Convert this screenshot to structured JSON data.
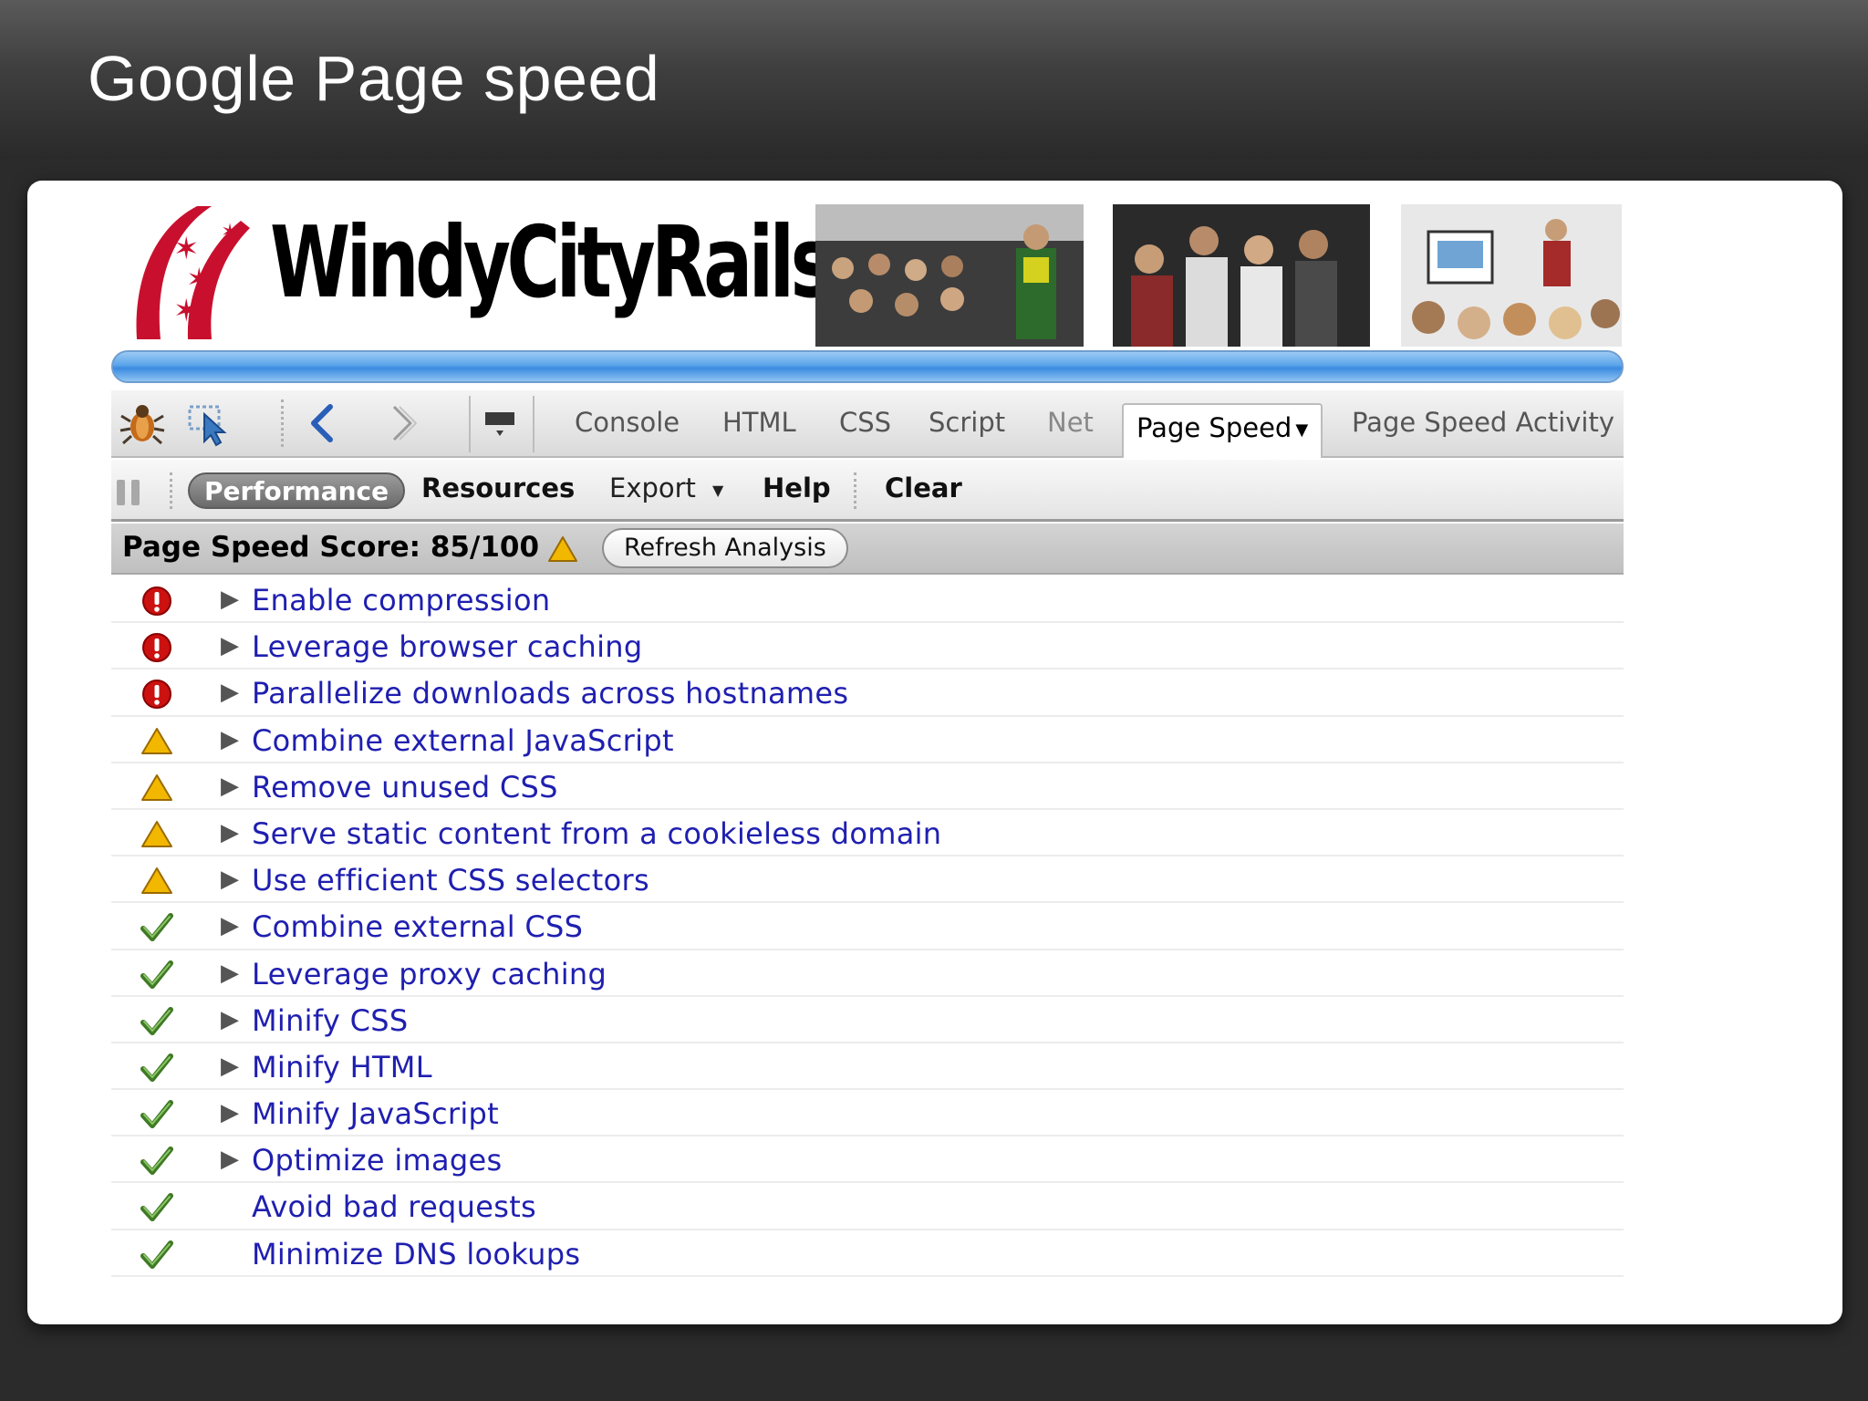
{
  "slide": {
    "title": "Google Page speed"
  },
  "banner": {
    "logo_text": "WindyCityRails",
    "photos": [
      "conference-audience-photo",
      "conference-crowd-photo",
      "conference-presentation-photo"
    ]
  },
  "toolbar": {
    "icons": [
      "firebug-icon",
      "inspect-icon",
      "back-icon",
      "forward-icon",
      "panel-menu-icon"
    ],
    "tabs": [
      {
        "label": "Console",
        "active": false
      },
      {
        "label": "HTML",
        "active": false
      },
      {
        "label": "CSS",
        "active": false
      },
      {
        "label": "Script",
        "active": false
      },
      {
        "label": "Net",
        "active": false
      },
      {
        "label": "Page Speed",
        "active": true
      },
      {
        "label": "Page Speed Activity",
        "active": false
      }
    ]
  },
  "subtoolbar": {
    "performance": "Performance",
    "resources": "Resources",
    "export": "Export",
    "help": "Help",
    "clear": "Clear"
  },
  "score": {
    "label": "Page Speed Score: 85/100",
    "value": 85,
    "max": 100,
    "refresh": "Refresh Analysis"
  },
  "rules": [
    {
      "name": "Enable compression",
      "status": "error",
      "expandable": true
    },
    {
      "name": "Leverage browser caching",
      "status": "error",
      "expandable": true
    },
    {
      "name": "Parallelize downloads across hostnames",
      "status": "error",
      "expandable": true
    },
    {
      "name": "Combine external JavaScript",
      "status": "warning",
      "expandable": true
    },
    {
      "name": "Remove unused CSS",
      "status": "warning",
      "expandable": true
    },
    {
      "name": "Serve static content from a cookieless domain",
      "status": "warning",
      "expandable": true
    },
    {
      "name": "Use efficient CSS selectors",
      "status": "warning",
      "expandable": true
    },
    {
      "name": "Combine external CSS",
      "status": "pass",
      "expandable": true
    },
    {
      "name": "Leverage proxy caching",
      "status": "pass",
      "expandable": true
    },
    {
      "name": "Minify CSS",
      "status": "pass",
      "expandable": true
    },
    {
      "name": "Minify HTML",
      "status": "pass",
      "expandable": true
    },
    {
      "name": "Minify JavaScript",
      "status": "pass",
      "expandable": true
    },
    {
      "name": "Optimize images",
      "status": "pass",
      "expandable": true
    },
    {
      "name": "Avoid bad requests",
      "status": "pass",
      "expandable": false
    },
    {
      "name": "Minimize DNS lookups",
      "status": "pass",
      "expandable": false
    }
  ],
  "colors": {
    "link": "#1f1fb0",
    "error": "#cc1111",
    "warning": "#f0b400",
    "pass": "#4a8a2a"
  }
}
